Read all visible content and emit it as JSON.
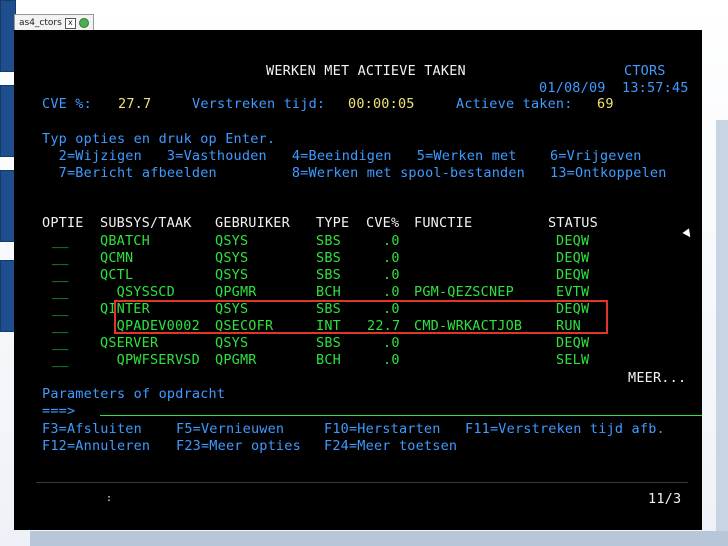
{
  "emulator": {
    "tab_title": "as4_ctors",
    "close_glyph": "x"
  },
  "header": {
    "title": "WERKEN MET ACTIEVE TAKEN",
    "system": "CTORS",
    "date": "01/08/09",
    "time": "13:57:45",
    "cpu_label": "CVE %:",
    "cpu_value": "27.7",
    "elapsed_label": "Verstreken tijd:",
    "elapsed_value": "00:00:05",
    "active_label": "Actieve taken:",
    "active_value": "69"
  },
  "instructions": {
    "line1": "Typ opties en druk op Enter.",
    "line2": "  2=Wijzigen   3=Vasthouden   4=Beeindigen   5=Werken met    6=Vrijgeven",
    "line3": "  7=Bericht afbeelden         8=Werken met spool-bestanden   13=Ontkoppelen"
  },
  "columns": {
    "optie": "OPTIE",
    "subsys": "SUBSYS/TAAK",
    "user": "GEBRUIKER",
    "type": "TYPE",
    "cpu": "CVE%",
    "function": "FUNCTIE",
    "status": "STATUS"
  },
  "rows": [
    {
      "opt": "__",
      "job": "QBATCH",
      "user": "QSYS",
      "type": "SBS",
      "cpu": ".0",
      "func": "",
      "status": "DEQW"
    },
    {
      "opt": "__",
      "job": "QCMN",
      "user": "QSYS",
      "type": "SBS",
      "cpu": ".0",
      "func": "",
      "status": "DEQW"
    },
    {
      "opt": "__",
      "job": "QCTL",
      "user": "QSYS",
      "type": "SBS",
      "cpu": ".0",
      "func": "",
      "status": "DEQW"
    },
    {
      "opt": "__",
      "job": "  QSYSSCD",
      "user": "QPGMR",
      "type": "BCH",
      "cpu": ".0",
      "func": "PGM-QEZSCNEP",
      "status": "EVTW"
    },
    {
      "opt": "__",
      "job": "QINTER",
      "user": "QSYS",
      "type": "SBS",
      "cpu": ".0",
      "func": "",
      "status": "DEQW"
    },
    {
      "opt": "__",
      "job": "  QPADEV0002",
      "user": "QSECOFR",
      "type": "INT",
      "cpu": "22.7",
      "func": "CMD-WRKACTJOB",
      "status": "RUN"
    },
    {
      "opt": "__",
      "job": "QSERVER",
      "user": "QSYS",
      "type": "SBS",
      "cpu": ".0",
      "func": "",
      "status": "DEQW"
    },
    {
      "opt": "__",
      "job": "  QPWFSERVSD",
      "user": "QPGMR",
      "type": "BCH",
      "cpu": ".0",
      "func": "",
      "status": "SELW"
    }
  ],
  "more": "MEER...",
  "command": {
    "label": "Parameters of opdracht",
    "prompt": "===>",
    "value": ""
  },
  "fkeys": {
    "line1": [
      {
        "label": "F3=Afsluiten",
        "name": "f3-exit-key"
      },
      {
        "label": "F5=Vernieuwen",
        "name": "f5-refresh-key"
      },
      {
        "label": "F10=Herstarten",
        "name": "f10-restart-key"
      },
      {
        "label": "F11=Verstreken tijd afb.",
        "name": "f11-elapsed-key"
      }
    ],
    "line2": [
      {
        "label": "F12=Annuleren",
        "name": "f12-cancel-key"
      },
      {
        "label": "F23=Meer opties",
        "name": "f23-more-options-key"
      },
      {
        "label": "F24=Meer toetsen",
        "name": "f24-more-keys-key"
      }
    ]
  },
  "status_bar": {
    "cursor_pos": "11/3",
    "left_mark": ":"
  },
  "colors": {
    "text_green": "#2de23d",
    "text_blue": "#3f9bff",
    "text_white": "#f2f2f2",
    "highlight": "#e0352b"
  }
}
